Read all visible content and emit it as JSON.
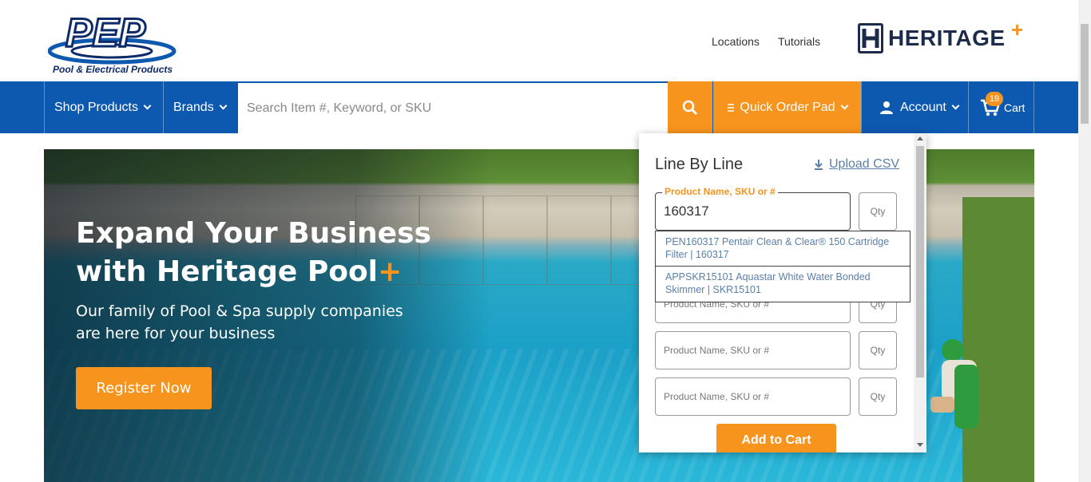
{
  "header": {
    "logo_text": "PEP",
    "logo_subtitle": "Pool & Electrical Products",
    "links": [
      "Locations",
      "Tutorials"
    ],
    "partner_logo": "HERITAGE",
    "partner_logo_suffix": "+"
  },
  "nav": {
    "shop_products": "Shop Products",
    "brands": "Brands",
    "search_placeholder": "Search Item #, Keyword, or SKU",
    "search_icon": "search-icon",
    "quick_order_pad": "Quick Order Pad",
    "account": "Account",
    "cart": "Cart",
    "cart_count": "19"
  },
  "hero": {
    "headline_line1": "Expand Your Business",
    "headline_line2": "with Heritage Pool",
    "headline_plus": "+",
    "subtext": "Our family of Pool & Spa supply companies  are here for your business",
    "cta": "Register Now"
  },
  "quick_order": {
    "tab_title": "Line By Line",
    "upload_label": "Upload CSV",
    "field_label": "Product Name, SKU or #",
    "field_value": "160317",
    "field_placeholder": "Product Name, SKU or #",
    "qty_placeholder": "Qty",
    "suggestions": [
      "PEN160317 Pentair Clean & Clear® 150 Cartridge Filter | 160317",
      "APPSKR15101 Aquastar White Water Bonded Skimmer | SKR15101"
    ],
    "add_to_cart": "Add to Cart"
  },
  "colors": {
    "nav_blue": "#0d59b0",
    "accent_orange": "#f7941d",
    "link_blue": "#5a7fa8"
  }
}
